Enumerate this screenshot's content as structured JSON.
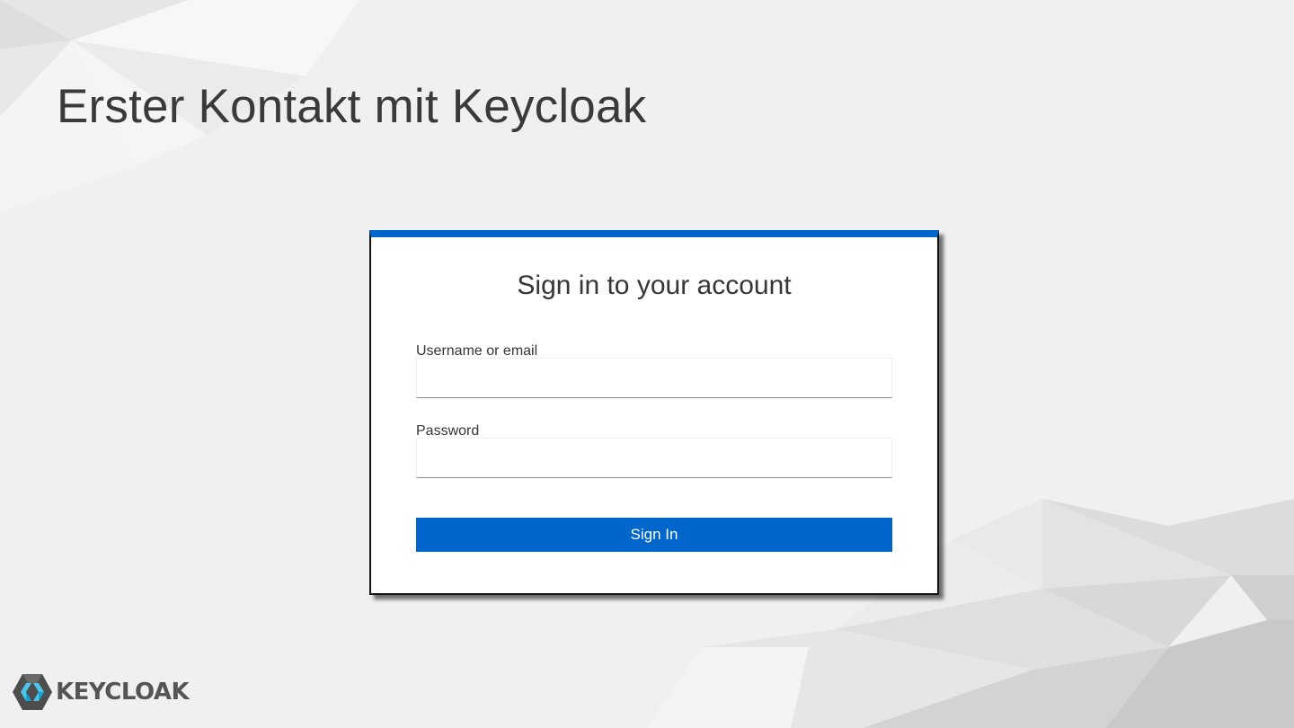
{
  "slide": {
    "title": "Erster Kontakt mit Keycloak"
  },
  "login": {
    "heading": "Sign in to your account",
    "username_label": "Username or email",
    "username_value": "",
    "password_label": "Password",
    "password_value": "",
    "submit_label": "Sign In"
  },
  "brand": {
    "name": "KEYCLOAK",
    "icon": "keycloak-logo-icon"
  },
  "colors": {
    "accent": "#0066cc",
    "background": "#f0f0f0",
    "title_text": "#3a3a3a"
  }
}
